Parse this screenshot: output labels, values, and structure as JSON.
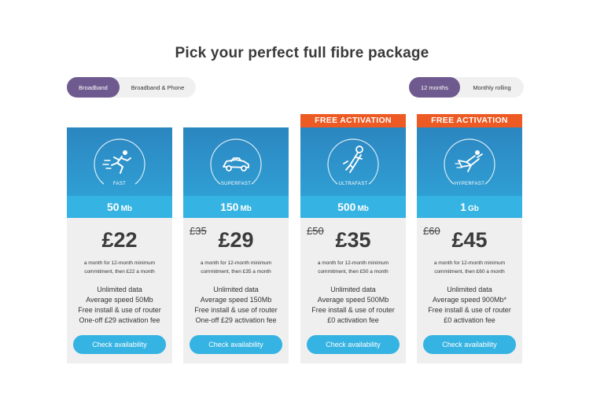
{
  "page": {
    "title": "Pick your perfect full fibre package"
  },
  "type_toggle": {
    "options": [
      "Broadband",
      "Broadband & Phone"
    ],
    "selected": "Broadband"
  },
  "term_toggle": {
    "options": [
      "12 months",
      "Monthly rolling"
    ],
    "selected": "12 months"
  },
  "colors": {
    "accent_purple": "#6e5a8e",
    "hero_blue": "#2c86c0",
    "speed_blue": "#35b3e2",
    "banner_orange": "#ee5a24",
    "card_bg": "#efefef"
  },
  "packages": [
    {
      "icon": "running-person-icon",
      "tier": "FAST",
      "banner": "",
      "speed_value": "50",
      "speed_unit": "Mb",
      "old_price": "",
      "price": "£22",
      "terms": "a month for 12-month minimum commitment, then £22 a month",
      "features": [
        "Unlimited data",
        "Average speed 50Mb",
        "Free install & use of router",
        "One-off £29 activation fee"
      ],
      "cta": "Check availability"
    },
    {
      "icon": "race-car-icon",
      "tier": "SUPERFAST",
      "banner": "",
      "speed_value": "150",
      "speed_unit": "Mb",
      "old_price": "£35",
      "price": "£29",
      "terms": "a month for 12-month minimum commitment, then £35 a month",
      "features": [
        "Unlimited data",
        "Average speed 150Mb",
        "Free install & use of router",
        "One-off £29 activation fee"
      ],
      "cta": "Check availability"
    },
    {
      "icon": "rocket-icon",
      "tier": "ULTRAFAST",
      "banner": "FREE ACTIVATION",
      "speed_value": "500",
      "speed_unit": "Mb",
      "old_price": "£50",
      "price": "£35",
      "terms": "a month for 12-month minimum commitment, then £50 a month",
      "features": [
        "Unlimited data",
        "Average speed 500Mb",
        "Free install & use of router",
        "£0 activation fee"
      ],
      "cta": "Check availability"
    },
    {
      "icon": "superhero-icon",
      "tier": "HYPERFAST",
      "banner": "FREE ACTIVATION",
      "speed_value": "1",
      "speed_unit": "Gb",
      "old_price": "£60",
      "price": "£45",
      "terms": "a month for 12-month minimum commitment, then £60 a month",
      "features": [
        "Unlimited data",
        "Average speed 900Mb*",
        "Free install & use of router",
        "£0 activation fee"
      ],
      "cta": "Check availability"
    }
  ]
}
